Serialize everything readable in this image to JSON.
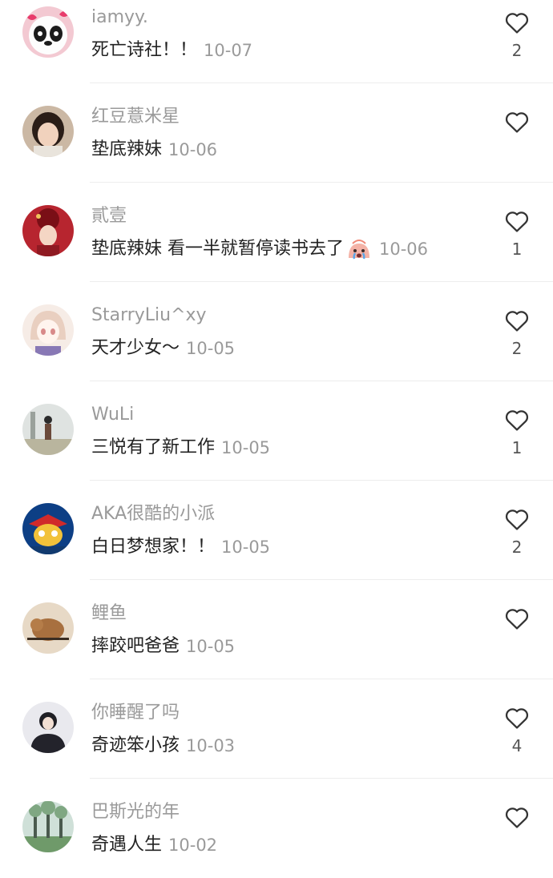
{
  "comments": [
    {
      "username": "iamyy.",
      "text": "死亡诗社！！",
      "emoji": "",
      "date": "10-07",
      "likes": "2",
      "avatar": "panda-avatar"
    },
    {
      "username": "红豆薏米星",
      "text": "垫底辣妹",
      "emoji": "",
      "date": "10-06",
      "likes": "",
      "avatar": "woman-avatar"
    },
    {
      "username": "貳壹",
      "text": "垫底辣妹 看一半就暂停读书去了",
      "emoji": "crying-face-emoji",
      "date": "10-06",
      "likes": "1",
      "avatar": "red-hat-avatar"
    },
    {
      "username": "StarryLiu^xy",
      "text": "天才少女～",
      "emoji": "",
      "date": "10-05",
      "likes": "2",
      "avatar": "anime-girl-avatar"
    },
    {
      "username": "WuLi",
      "text": "三悦有了新工作",
      "emoji": "",
      "date": "10-05",
      "likes": "1",
      "avatar": "outdoor-person-avatar"
    },
    {
      "username": "AKA很酷的小派",
      "text": "白日梦想家！！",
      "emoji": "",
      "date": "10-05",
      "likes": "2",
      "avatar": "cartoon-hero-avatar"
    },
    {
      "username": "鲤鱼",
      "text": "摔跤吧爸爸",
      "emoji": "",
      "date": "10-05",
      "likes": "",
      "avatar": "animal-avatar"
    },
    {
      "username": "你睡醒了吗",
      "text": "奇迹笨小孩",
      "emoji": "",
      "date": "10-03",
      "likes": "4",
      "avatar": "dark-hoodie-avatar"
    },
    {
      "username": "巴斯光的年",
      "text": "奇遇人生",
      "emoji": "",
      "date": "10-02",
      "likes": "",
      "avatar": "trees-avatar"
    }
  ],
  "colors": {
    "username": "#9a9a9a",
    "comment_text": "#222222",
    "date": "#9a9a9a",
    "like_icon": "#333333",
    "divider": "#ededed"
  },
  "icons": {
    "like": "heart-outline-icon"
  }
}
